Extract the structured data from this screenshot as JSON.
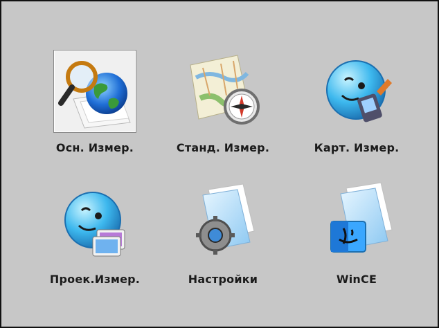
{
  "window": {
    "accent": "#c7c7c7",
    "border": "#111111"
  },
  "apps": [
    {
      "label": "Осн. Измер.",
      "icon": "magnifier-globe-icon",
      "selected": true
    },
    {
      "label": "Станд. Измер.",
      "icon": "map-compass-icon",
      "selected": false
    },
    {
      "label": "Карт. Измер.",
      "icon": "smiley-pda-icon",
      "selected": false
    },
    {
      "label": "Проек.Измер.",
      "icon": "smiley-picture-icon",
      "selected": false
    },
    {
      "label": "Настройки",
      "icon": "folder-gear-icon",
      "selected": false
    },
    {
      "label": "WinCE",
      "icon": "folder-finder-icon",
      "selected": false
    }
  ]
}
